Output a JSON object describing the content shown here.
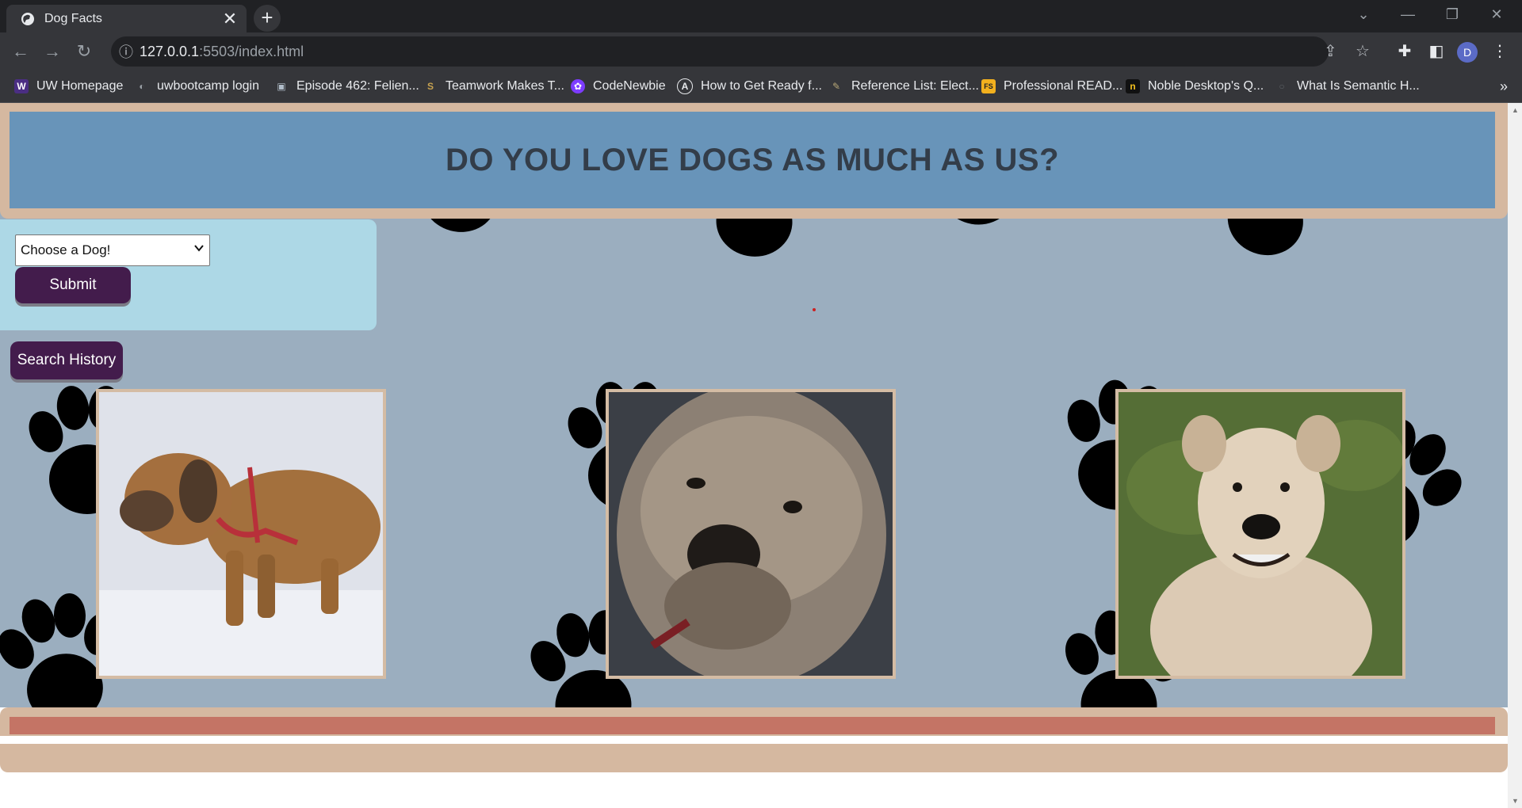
{
  "browser": {
    "tab_title": "Dog Facts",
    "tab_close": "✕",
    "new_tab": "+",
    "url_host": "127.0.0.1",
    "url_path": ":5503/index.html",
    "avatar_letter": "D",
    "bookmarks": [
      {
        "label": "UW Homepage",
        "icon": "W",
        "color": "#4b2e83"
      },
      {
        "label": "uwbootcamp login",
        "icon": "◐",
        "color": "#5f6368"
      },
      {
        "label": "Episode 462: Felien...",
        "icon": "▣",
        "color": "#7d8b99"
      },
      {
        "label": "Teamwork Makes T...",
        "icon": "S",
        "color": "#c7a250"
      },
      {
        "label": "CodeNewbie",
        "icon": "✿",
        "color": "#7d3cff"
      },
      {
        "label": "How to Get Ready f...",
        "icon": "A",
        "color": "#202124"
      },
      {
        "label": "Reference List: Elect...",
        "icon": "✎",
        "color": "#8a7a55"
      },
      {
        "label": "Professional READ...",
        "icon": "FS",
        "color": "#f2b01e"
      },
      {
        "label": "Noble Desktop's Q...",
        "icon": "n",
        "color": "#111111"
      },
      {
        "label": "What Is Semantic H...",
        "icon": "○",
        "color": "#5f6368"
      }
    ],
    "bookmarks_overflow": "»"
  },
  "page": {
    "header_title": "DO YOU LOVE DOGS AS MUCH AS US?",
    "select_value": "Choose a Dog!",
    "submit_label": "Submit",
    "history_label": "Search History"
  },
  "colors": {
    "header_bg": "#6894b9",
    "frame": "#d5b8a0",
    "form_bg": "#add8e6",
    "button_bg": "#431c4c",
    "footer_bar": "#c47465",
    "page_bg": "#9baebf"
  }
}
